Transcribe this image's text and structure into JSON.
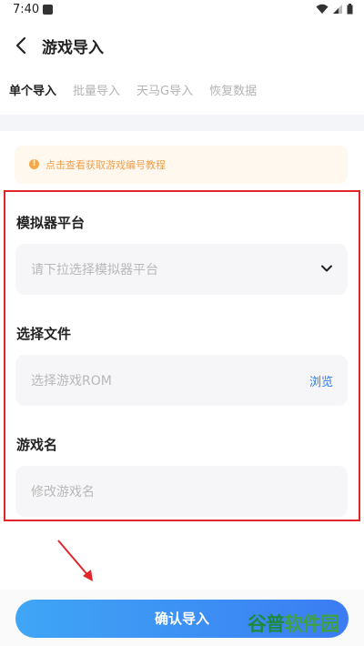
{
  "status_bar": {
    "time": "7:40"
  },
  "header": {
    "title": "游戏导入"
  },
  "tabs": [
    {
      "label": "单个导入",
      "active": true
    },
    {
      "label": "批量导入",
      "active": false
    },
    {
      "label": "天马G导入",
      "active": false
    },
    {
      "label": "恢复数据",
      "active": false
    }
  ],
  "notice": {
    "text": "点击查看获取游戏编号教程",
    "icon": "info-icon",
    "color": "#f0a04b"
  },
  "form": {
    "emulator": {
      "label": "模拟器平台",
      "placeholder": "请下拉选择模拟器平台"
    },
    "file": {
      "label": "选择文件",
      "placeholder": "选择游戏ROM",
      "browse_label": "浏览"
    },
    "name": {
      "label": "游戏名",
      "placeholder": "修改游戏名"
    }
  },
  "confirm_button": {
    "label": "确认导入"
  },
  "watermark": {
    "first": "谷普",
    "rest": "软件园"
  },
  "colors": {
    "accent": "#2d7be8",
    "highlight_border": "#e0252b",
    "button_gradient_start": "#3fa6f5",
    "button_gradient_end": "#3b7cf3"
  }
}
